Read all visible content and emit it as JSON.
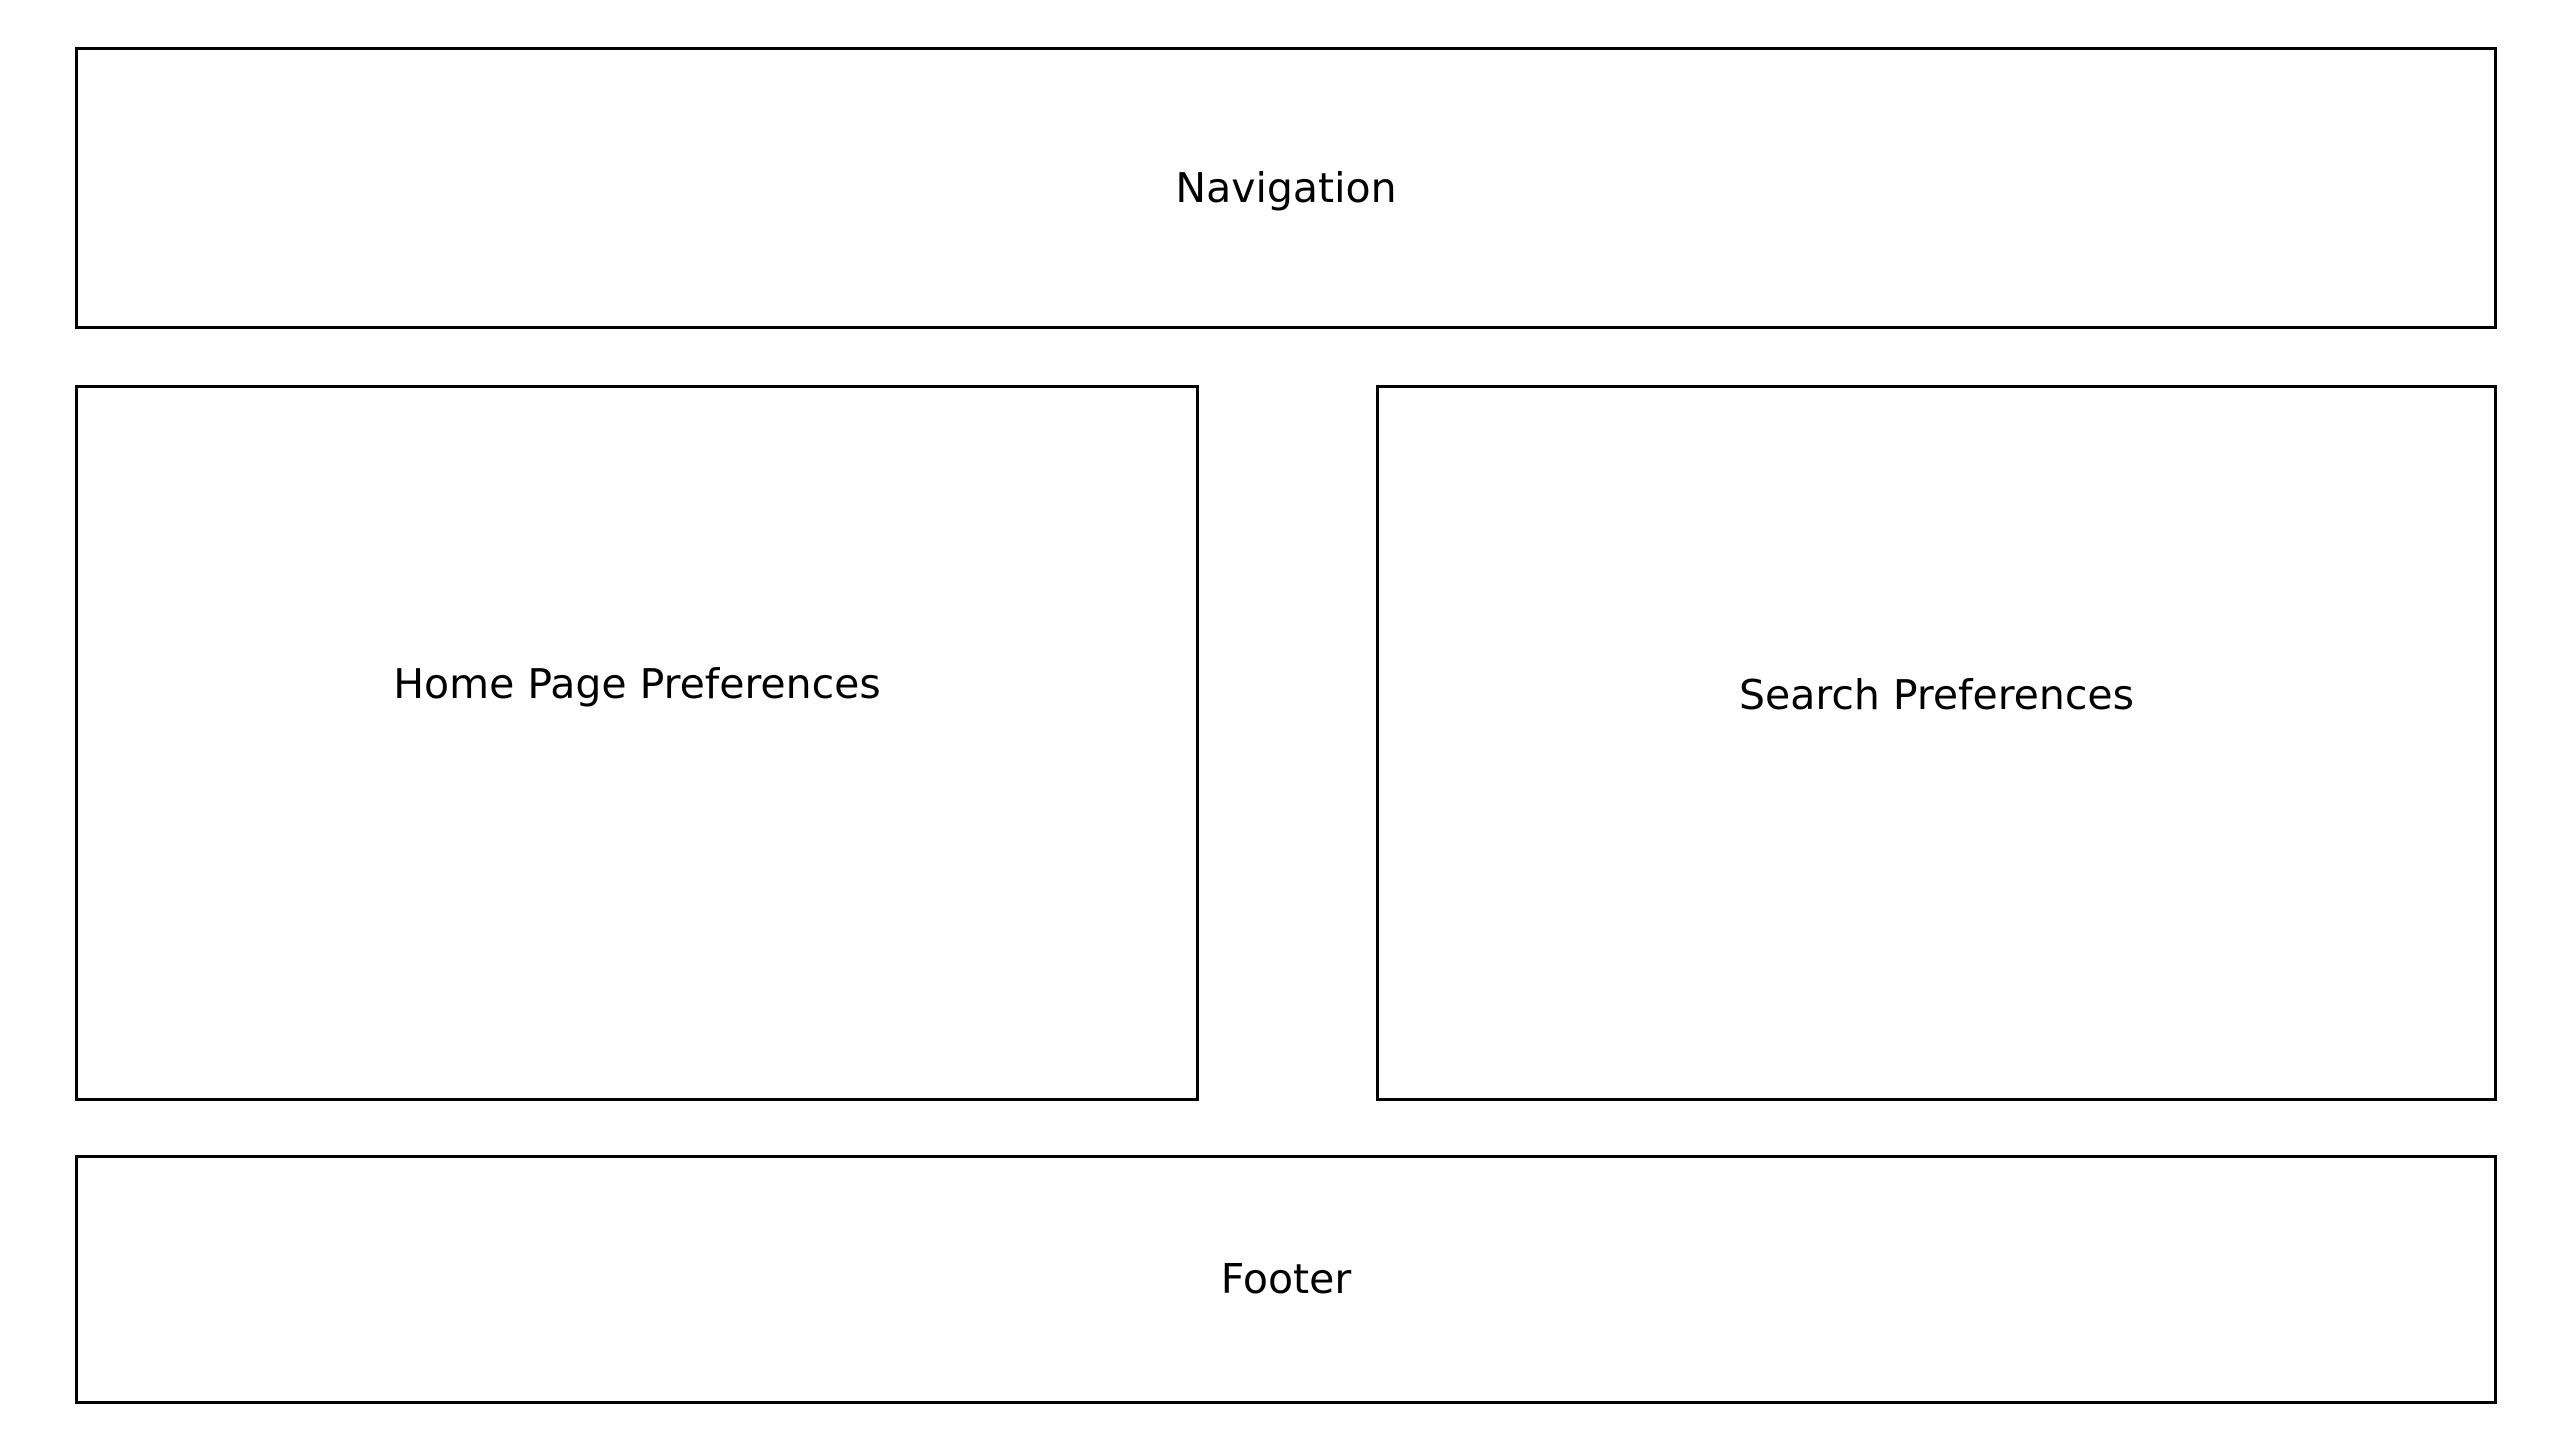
{
  "diagram": {
    "navigation": {
      "label": "Navigation"
    },
    "home_page_preferences": {
      "label": "Home Page Preferences"
    },
    "search_preferences": {
      "label": "Search Preferences"
    },
    "footer": {
      "label": "Footer"
    }
  },
  "colors": {
    "border": "#000000",
    "background": "#ffffff",
    "text": "#000000"
  }
}
